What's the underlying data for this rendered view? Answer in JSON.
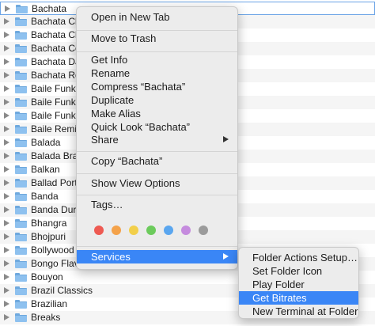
{
  "finder_list": {
    "rows": [
      {
        "name": "Bachata",
        "selected": true
      },
      {
        "name": "Bachata Cla"
      },
      {
        "name": "Bachata Clu"
      },
      {
        "name": "Bachata Co"
      },
      {
        "name": "Bachata DJ"
      },
      {
        "name": "Bachata Re"
      },
      {
        "name": "Baile Funk"
      },
      {
        "name": "Baile Funk"
      },
      {
        "name": "Baile Funk"
      },
      {
        "name": "Baile Remix"
      },
      {
        "name": "Balada"
      },
      {
        "name": "Balada Braz"
      },
      {
        "name": "Balkan"
      },
      {
        "name": "Ballad Portu"
      },
      {
        "name": "Banda"
      },
      {
        "name": "Banda Dura"
      },
      {
        "name": "Bhangra"
      },
      {
        "name": "Bhojpuri"
      },
      {
        "name": "Bollywood"
      },
      {
        "name": "Bongo Flava"
      },
      {
        "name": "Bouyon"
      },
      {
        "name": "Brazil Classics"
      },
      {
        "name": "Brazilian"
      },
      {
        "name": "Breaks"
      }
    ]
  },
  "context_menu": {
    "open_new_tab": "Open in New Tab",
    "move_to_trash": "Move to Trash",
    "get_info": "Get Info",
    "rename": "Rename",
    "compress": "Compress “Bachata”",
    "duplicate": "Duplicate",
    "make_alias": "Make Alias",
    "quick_look": "Quick Look “Bachata”",
    "share": "Share",
    "copy": "Copy “Bachata”",
    "show_view_options": "Show View Options",
    "tags": "Tags…",
    "tag_colors": [
      "#ee5a52",
      "#f4a24a",
      "#f2cf4a",
      "#6ccb5c",
      "#5aa6ef",
      "#c58bde",
      "#9b9b9b"
    ],
    "services": "Services"
  },
  "services_menu": {
    "items": [
      "Folder Actions Setup…",
      "Set Folder Icon",
      "Play Folder",
      "Get Bitrates",
      "New Terminal at Folder"
    ],
    "highlighted_index": 3
  },
  "colors": {
    "highlight": "#3a86f6",
    "folder": "#8ec1ef"
  }
}
